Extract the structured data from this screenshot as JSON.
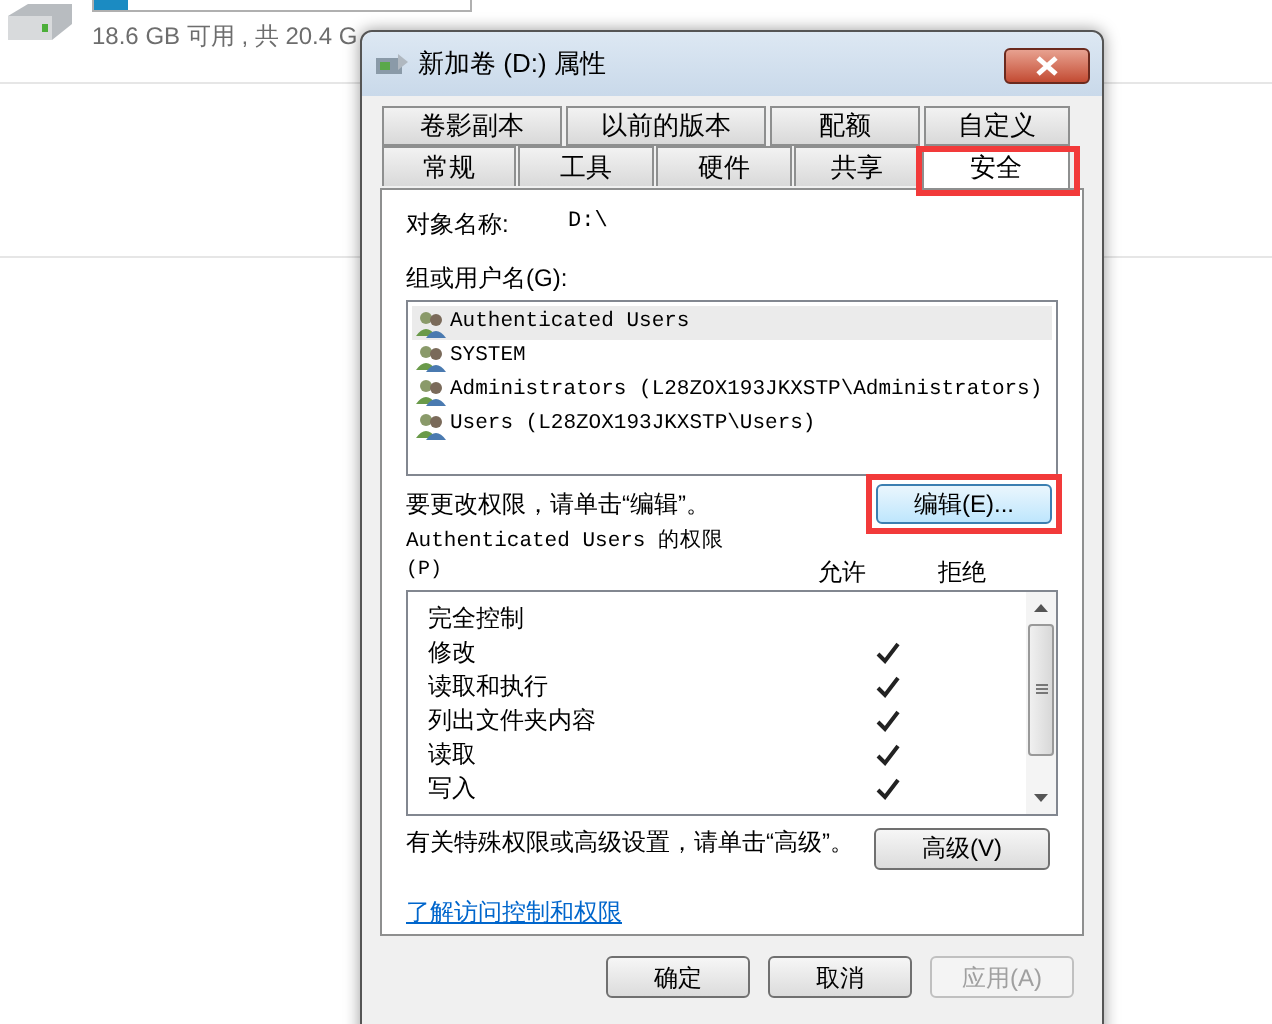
{
  "drive": {
    "free_text": "18.6 GB 可用 , 共 20.4 G",
    "level": 0.09
  },
  "window": {
    "title": "新加卷 (D:) 属性"
  },
  "tabs_row_1": [
    {
      "label": "卷影副本",
      "selected": false
    },
    {
      "label": "以前的版本",
      "selected": false
    },
    {
      "label": "配额",
      "selected": false
    },
    {
      "label": "自定义",
      "selected": false
    }
  ],
  "tabs_row_2": [
    {
      "label": "常规",
      "selected": false
    },
    {
      "label": "工具",
      "selected": false
    },
    {
      "label": "硬件",
      "selected": false
    },
    {
      "label": "共享",
      "selected": false
    },
    {
      "label": "安全",
      "selected": true,
      "highlighted": true
    }
  ],
  "object_name": {
    "label": "对象名称:",
    "value": "D:\\"
  },
  "groups": {
    "label": "组或用户名(G):",
    "items": [
      {
        "name": "Authenticated Users",
        "selected": true
      },
      {
        "name": "SYSTEM",
        "selected": false
      },
      {
        "name": "Administrators (L28ZOX193JKXSTP\\Administrators)",
        "selected": false
      },
      {
        "name": "Users (L28ZOX193JKXSTP\\Users)",
        "selected": false
      }
    ]
  },
  "edit_hint": "要更改权限，请单击“编辑”。",
  "edit_button": {
    "label": "编辑(E)...",
    "highlighted": true
  },
  "permissions": {
    "title": "Authenticated Users 的权限",
    "title_suffix": "(P)",
    "allow_header": "允许",
    "deny_header": "拒绝",
    "rows": [
      {
        "name": "完全控制",
        "allow": false
      },
      {
        "name": "修改",
        "allow": true
      },
      {
        "name": "读取和执行",
        "allow": true
      },
      {
        "name": "列出文件夹内容",
        "allow": true
      },
      {
        "name": "读取",
        "allow": true
      },
      {
        "name": "写入",
        "allow": true
      }
    ]
  },
  "advanced_hint": "有关特殊权限或高级设置，请单击“高级”。",
  "advanced_button": {
    "label": "高级(V)"
  },
  "help_link": "了解访问控制和权限",
  "buttons": [
    {
      "label": "确定",
      "disabled": false
    },
    {
      "label": "取消",
      "disabled": false
    },
    {
      "label": "应用(A)",
      "disabled": true
    }
  ]
}
